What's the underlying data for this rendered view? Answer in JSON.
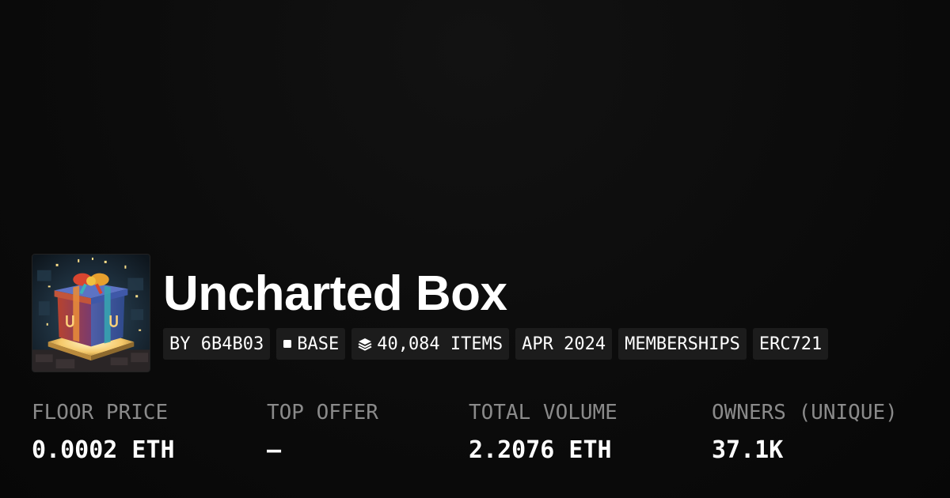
{
  "collection": {
    "title": "Uncharted Box",
    "image_icon": "gift-box-artwork"
  },
  "tags": [
    {
      "label": "BY 6B4B03",
      "icon": null
    },
    {
      "label": "BASE",
      "icon": "chain-square-icon"
    },
    {
      "label": "40,084 ITEMS",
      "icon": "layers-icon"
    },
    {
      "label": "APR 2024",
      "icon": null
    },
    {
      "label": "MEMBERSHIPS",
      "icon": null
    },
    {
      "label": "ERC721",
      "icon": null
    }
  ],
  "stats": [
    {
      "label": "FLOOR PRICE",
      "value": "0.0002 ETH"
    },
    {
      "label": "TOP OFFER",
      "value": "—"
    },
    {
      "label": "TOTAL VOLUME",
      "value": "2.2076 ETH"
    },
    {
      "label": "OWNERS (UNIQUE)",
      "value": "37.1K"
    }
  ],
  "colors": {
    "background": "#0b0b0b",
    "tag_background": "#1c1c1c",
    "label_gray": "#8a8a8a",
    "text_white": "#ffffff"
  }
}
